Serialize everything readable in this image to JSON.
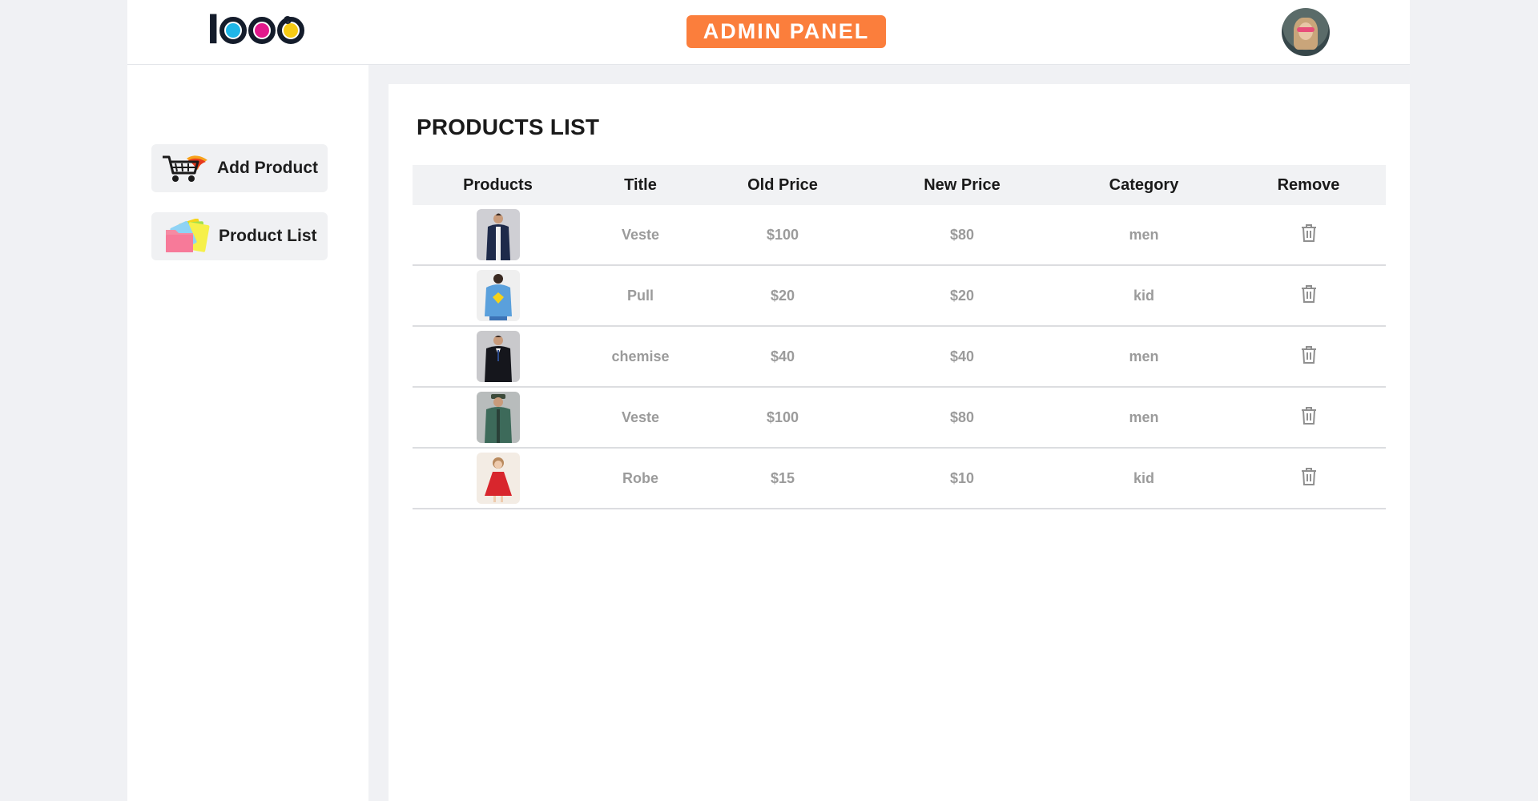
{
  "header": {
    "logo_text": "logo",
    "title": "ADMIN PANEL",
    "accent_color": "#fb7e3c"
  },
  "sidebar": {
    "items": [
      {
        "label": "Add Product",
        "icon": "cart-icon"
      },
      {
        "label": "Product List",
        "icon": "folder-icon"
      }
    ]
  },
  "main": {
    "title": "PRODUCTS LIST",
    "columns": [
      "Products",
      "Title",
      "Old Price",
      "New Price",
      "Category",
      "Remove"
    ],
    "rows": [
      {
        "image": "product-jacket-navy",
        "title": "Veste",
        "old_price": "$100",
        "new_price": "$80",
        "category": "men"
      },
      {
        "image": "product-hoodie-blue",
        "title": "Pull",
        "old_price": "$20",
        "new_price": "$20",
        "category": "kid"
      },
      {
        "image": "product-suit-black",
        "title": "chemise",
        "old_price": "$40",
        "new_price": "$40",
        "category": "men"
      },
      {
        "image": "product-jacket-green",
        "title": "Veste",
        "old_price": "$100",
        "new_price": "$80",
        "category": "men"
      },
      {
        "image": "product-dress-red",
        "title": "Robe",
        "old_price": "$15",
        "new_price": "$10",
        "category": "kid"
      }
    ]
  }
}
